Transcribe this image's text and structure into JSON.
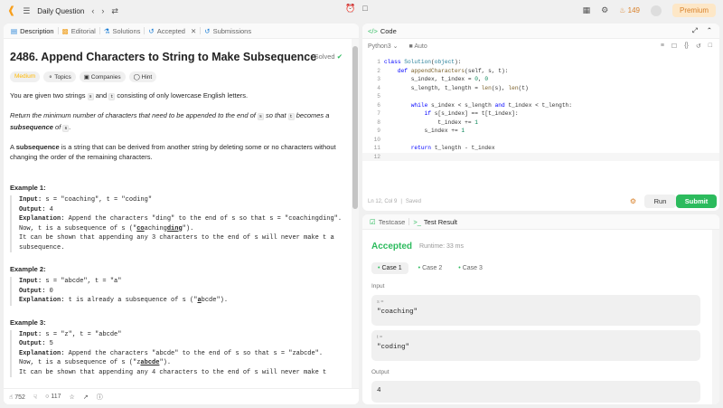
{
  "topbar": {
    "title": "Daily Question",
    "streak": "149",
    "premium": "Premium"
  },
  "tabs": {
    "description": "Description",
    "editorial": "Editorial",
    "solutions": "Solutions",
    "accepted": "Accepted",
    "submissions": "Submissions"
  },
  "problem": {
    "title": "2486. Append Characters to String to Make Subsequence",
    "solved": "Solved",
    "tags": {
      "difficulty": "Medium",
      "topics": "Topics",
      "companies": "Companies",
      "hint": "Hint"
    },
    "p1a": "You are given two strings ",
    "p1s": "s",
    "p1b": " and ",
    "p1t": "t",
    "p1c": " consisting of only lowercase English letters.",
    "p2a": "Return the minimum number of characters that need to be appended to the end of ",
    "p2s": "s",
    "p2b": " so that ",
    "p2t": "t",
    "p2c": " becomes a ",
    "p2d": "subsequence",
    "p2e": " of ",
    "p2f": "s",
    "p2g": ".",
    "p3a": "A ",
    "p3b": "subsequence",
    "p3c": " is a string that can be derived from another string by deleting some or no characters without changing the order of the remaining characters.",
    "ex1h": "Example 1:",
    "ex1": {
      "in_l": "Input:",
      "in_v": " s = \"coaching\", t = \"coding\"",
      "out_l": "Output:",
      "out_v": " 4",
      "exp_l": "Explanation:",
      "exp_v": " Append the characters \"ding\" to the end of s so that s = \"coachingding\".",
      "l4a": "Now, t is a subsequence of s (\"",
      "l4u1": "co",
      "l4m1": "aching",
      "l4u2": "ding",
      "l4e": "\").",
      "l5": "It can be shown that appending any 3 characters to the end of s will never make t a subsequence."
    },
    "ex2h": "Example 2:",
    "ex2": {
      "in_l": "Input:",
      "in_v": " s = \"abcde\", t = \"a\"",
      "out_l": "Output:",
      "out_v": " 0",
      "exp_l": "Explanation:",
      "exp_a": " t is already a subsequence of s (\"",
      "exp_u": "a",
      "exp_b": "bcde\")."
    },
    "ex3h": "Example 3:",
    "ex3": {
      "in_l": "Input:",
      "in_v": " s = \"z\", t = \"abcde\"",
      "out_l": "Output:",
      "out_v": " 5",
      "exp_l": "Explanation:",
      "exp_v": " Append the characters \"abcde\" to the end of s so that s = \"zabcde\".",
      "l4a": "Now, t is a subsequence of s (\"z",
      "l4u": "abcde",
      "l4e": "\").",
      "l5": "It can be shown that appending any 4 characters to the end of s will never make t"
    }
  },
  "bottombar": {
    "likes": "752",
    "comments": "117"
  },
  "code": {
    "tab": "Code",
    "language": "Python3",
    "auto": "Auto",
    "lines": [
      [
        "1",
        "class Solution(object):"
      ],
      [
        "2",
        "    def appendCharacters(self, s, t):"
      ],
      [
        "3",
        "        s_index, t_index = 0, 0"
      ],
      [
        "4",
        "        s_length, t_length = len(s), len(t)"
      ],
      [
        "5",
        ""
      ],
      [
        "6",
        "        while s_index < s_length and t_index < t_length:"
      ],
      [
        "7",
        "            if s[s_index] == t[t_index]:"
      ],
      [
        "8",
        "                t_index += 1"
      ],
      [
        "9",
        "            s_index += 1"
      ],
      [
        "10",
        ""
      ],
      [
        "11",
        "        return t_length - t_index"
      ],
      [
        "12",
        ""
      ]
    ],
    "position": "Ln 12, Col 9",
    "saved": "Saved",
    "run": "Run",
    "submit": "Submit"
  },
  "result": {
    "testcase_tab": "Testcase",
    "result_tab": "Test Result",
    "status": "Accepted",
    "runtime": "Runtime: 33 ms",
    "cases": [
      "Case 1",
      "Case 2",
      "Case 3"
    ],
    "input_label": "Input",
    "s_key": "s =",
    "s_val": "\"coaching\"",
    "t_key": "t =",
    "t_val": "\"coding\"",
    "output_label": "Output",
    "output_val": "4"
  }
}
